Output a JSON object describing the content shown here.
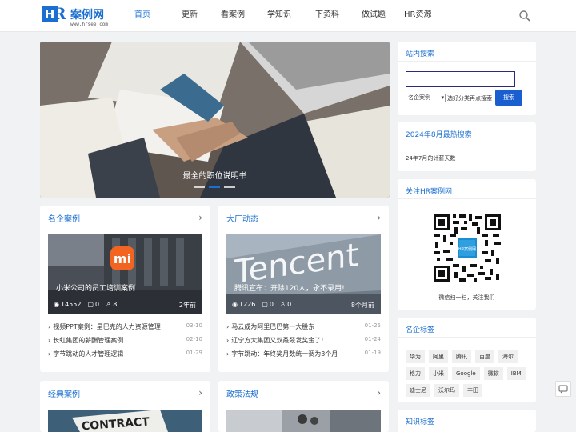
{
  "header": {
    "logo_text": "案例网",
    "logo_url": "www.hrsee.com",
    "nav": [
      "首页",
      "更新",
      "看案例",
      "学知识",
      "下资料",
      "做试题",
      "HR资源"
    ],
    "active_index": 0
  },
  "hero": {
    "caption": "最全的职位说明书",
    "slide_count": 3,
    "active_slide": 1
  },
  "cards": [
    {
      "title": "名企案例",
      "thumb_title": "小米公司的员工培训案例",
      "views": "14552",
      "comments": "0",
      "likes": "8",
      "age": "2年前",
      "items": [
        {
          "title": "视频PPT案例：星巴克的人力资源管理",
          "date": "03-10"
        },
        {
          "title": "长虹集团的薪酬管理案例",
          "date": "02-10"
        },
        {
          "title": "字节跳动的人才管理逻辑",
          "date": "01-29"
        }
      ]
    },
    {
      "title": "大厂动态",
      "thumb_title": "腾讯宣布：开除120人，永不录用!",
      "views": "1226",
      "comments": "0",
      "likes": "0",
      "age": "8个月前",
      "items": [
        {
          "title": "马云成为阿里巴巴第一大股东",
          "date": "01-25"
        },
        {
          "title": "辽宁方大集团又双叒叕发奖金了!",
          "date": "01-24"
        },
        {
          "title": "字节跳动：年终奖月数统一调为3个月",
          "date": "01-19"
        }
      ]
    },
    {
      "title": "经典案例"
    },
    {
      "title": "政策法规"
    }
  ],
  "sidebar": {
    "search": {
      "title": "站内搜索",
      "input_value": "",
      "select_value": "名企案例",
      "hint": "选好分类再点搜索",
      "button": "搜索"
    },
    "hot": {
      "title": "2024年8月最热搜索",
      "item": "24年7月的计薪天数"
    },
    "follow": {
      "title": "关注HR案例网",
      "qr_label": "HR案例网",
      "caption": "微信扫一扫，关注我们"
    },
    "tags": {
      "title": "名企标签",
      "items": [
        "华为",
        "阿里",
        "腾讯",
        "百度",
        "海尔",
        "格力",
        "小米",
        "Google",
        "微软",
        "IBM",
        "迪士尼",
        "沃尔玛",
        "丰田"
      ]
    },
    "knowledge": {
      "title": "知识标签"
    }
  },
  "colors": {
    "accent": "#1a6fd0",
    "background": "#f1f2f3"
  }
}
